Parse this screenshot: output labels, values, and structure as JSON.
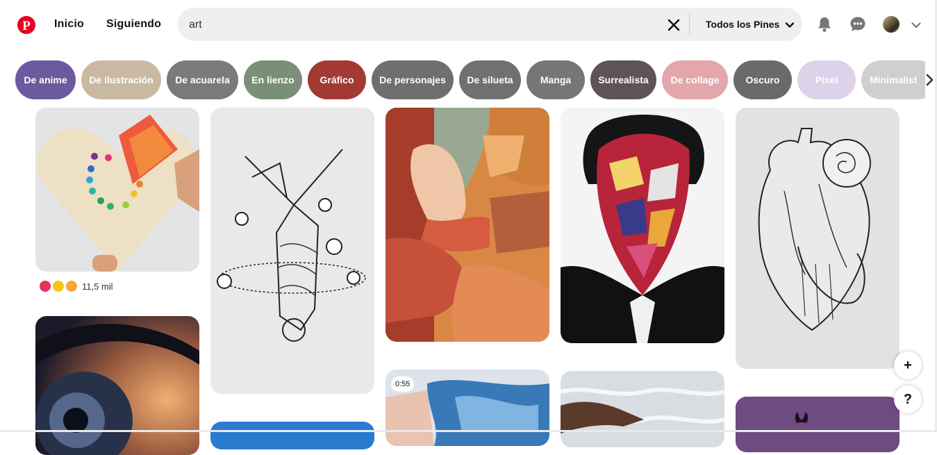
{
  "header": {
    "nav": {
      "home": "Inicio",
      "following": "Siguiendo"
    },
    "search": {
      "value": "art"
    },
    "filter_label": "Todos los Pines",
    "icons": [
      "pinterest-logo-icon",
      "close-icon",
      "chevron-down-icon",
      "bell-icon",
      "chat-icon",
      "chevron-down-icon"
    ],
    "brand_color": "#e60023"
  },
  "chips": [
    {
      "label": "De anime",
      "color": "#6b5a9e"
    },
    {
      "label": "De ilustración",
      "color": "#c9b9a0"
    },
    {
      "label": "De acuarela",
      "color": "#7a7a7a"
    },
    {
      "label": "En lienzo",
      "color": "#7a8f77"
    },
    {
      "label": "Gráfico",
      "color": "#a23a33"
    },
    {
      "label": "De personajes",
      "color": "#6f6f6f"
    },
    {
      "label": "De silueta",
      "color": "#707070"
    },
    {
      "label": "Manga",
      "color": "#767676"
    },
    {
      "label": "Surrealista",
      "color": "#5e5358"
    },
    {
      "label": "De collage",
      "color": "#e2a6ab"
    },
    {
      "label": "Oscuro",
      "color": "#6a6a6a"
    },
    {
      "label": "Pixel",
      "color": "#ddd2ea"
    },
    {
      "label": "Minimalist",
      "color": "#cfcfcf"
    }
  ],
  "pins": {
    "reactions_count": "11,5 mil",
    "video_duration": "0:55"
  },
  "fab": {
    "add": "+",
    "help": "?"
  }
}
